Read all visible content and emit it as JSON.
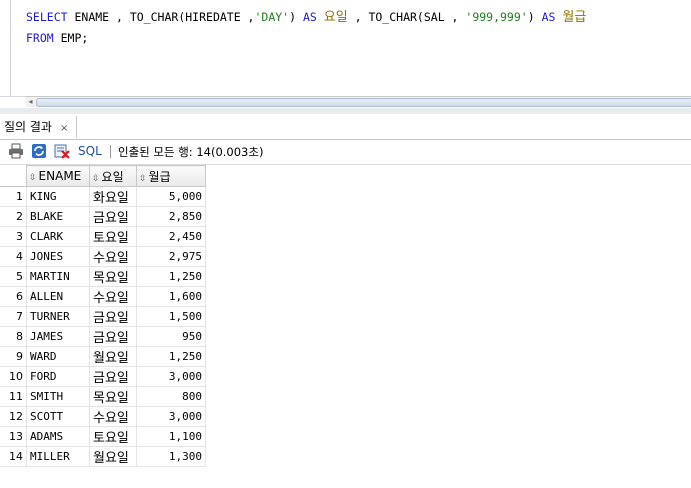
{
  "editor": {
    "line1": {
      "kw_select": "SELECT",
      "part1": " ENAME , TO_CHAR(HIREDATE ,",
      "str_day": "'DAY'",
      "part2": ") ",
      "kw_as1": "AS",
      "alias1": "요일",
      "part3": " , TO_CHAR(SAL , ",
      "str_fmt": "'999,999'",
      "part4": ") ",
      "kw_as2": "AS",
      "alias2": "월급"
    },
    "line2": {
      "kw_from": "FROM",
      "part1": " EMP;"
    }
  },
  "results_tab": {
    "label": "질의 결과",
    "close": "×"
  },
  "toolbar": {
    "sql_label": "SQL",
    "status": "인출된 모든 행: 14(0.003초)",
    "icons": [
      "print-icon",
      "refresh-icon",
      "delete-icon"
    ]
  },
  "colors": {
    "keyword": "#1c1cc4",
    "string": "#1e7f1e",
    "alias": "#8a7400",
    "sql_label": "#1f4f9c"
  },
  "grid": {
    "columns": [
      "ENAME",
      "요일",
      "월급"
    ],
    "rows": [
      {
        "n": "1",
        "ename": "KING",
        "day": "화요일",
        "sal": "5,000"
      },
      {
        "n": "2",
        "ename": "BLAKE",
        "day": "금요일",
        "sal": "2,850"
      },
      {
        "n": "3",
        "ename": "CLARK",
        "day": "토요일",
        "sal": "2,450"
      },
      {
        "n": "4",
        "ename": "JONES",
        "day": "수요일",
        "sal": "2,975"
      },
      {
        "n": "5",
        "ename": "MARTIN",
        "day": "목요일",
        "sal": "1,250"
      },
      {
        "n": "6",
        "ename": "ALLEN",
        "day": "수요일",
        "sal": "1,600"
      },
      {
        "n": "7",
        "ename": "TURNER",
        "day": "금요일",
        "sal": "1,500"
      },
      {
        "n": "8",
        "ename": "JAMES",
        "day": "금요일",
        "sal": "950"
      },
      {
        "n": "9",
        "ename": "WARD",
        "day": "월요일",
        "sal": "1,250"
      },
      {
        "n": "10",
        "ename": "FORD",
        "day": "금요일",
        "sal": "3,000"
      },
      {
        "n": "11",
        "ename": "SMITH",
        "day": "목요일",
        "sal": "800"
      },
      {
        "n": "12",
        "ename": "SCOTT",
        "day": "수요일",
        "sal": "3,000"
      },
      {
        "n": "13",
        "ename": "ADAMS",
        "day": "토요일",
        "sal": "1,100"
      },
      {
        "n": "14",
        "ename": "MILLER",
        "day": "월요일",
        "sal": "1,300"
      }
    ]
  }
}
